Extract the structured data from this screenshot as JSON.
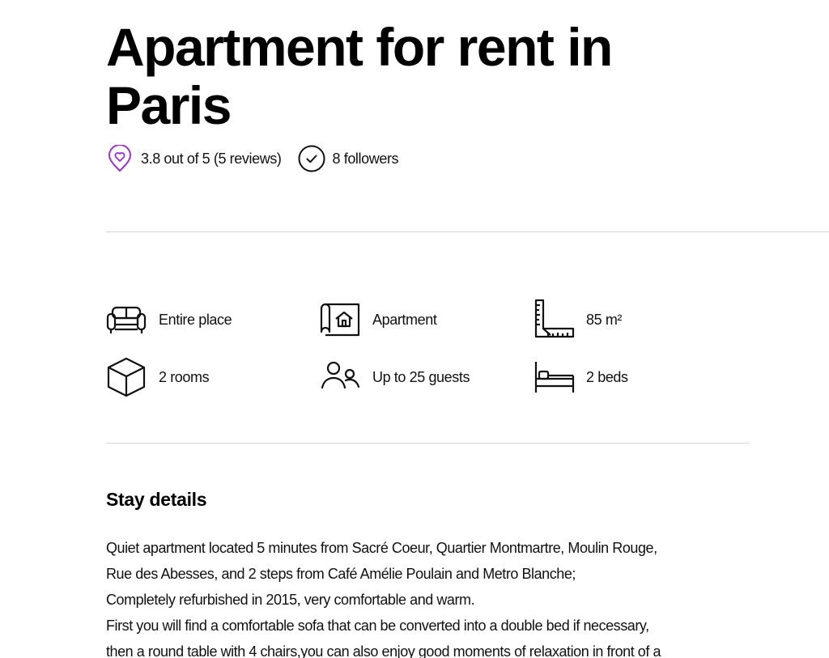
{
  "listing": {
    "title": "Apartment for rent in Paris",
    "rating_text": "3.8 out of 5 (5 reviews)",
    "followers_text": "8 followers",
    "accent_color": "#9b30d9"
  },
  "features": [
    {
      "icon": "sofa-icon",
      "label": "Entire place"
    },
    {
      "icon": "floor-plan-icon",
      "label": "Apartment"
    },
    {
      "icon": "ruler-icon",
      "label": "85 m²"
    },
    {
      "icon": "cube-icon",
      "label": "2 rooms"
    },
    {
      "icon": "guests-icon",
      "label": "Up to 25 guests"
    },
    {
      "icon": "bed-icon",
      "label": "2 beds"
    }
  ],
  "details": {
    "heading": "Stay details",
    "lines": [
      "Quiet apartment located 5 minutes from Sacré Coeur, Quartier Montmartre, Moulin Rouge,",
      "Rue des Abesses, and 2 steps from Café Amélie Poulain and Metro Blanche;",
      "Completely refurbished in 2015, very comfortable and warm.",
      "First you will find a comfortable sofa that can be converted into a double bed if necessary,",
      "then a round table with 4 chairs,you can also enjoy good moments of relaxation in front of a"
    ]
  }
}
